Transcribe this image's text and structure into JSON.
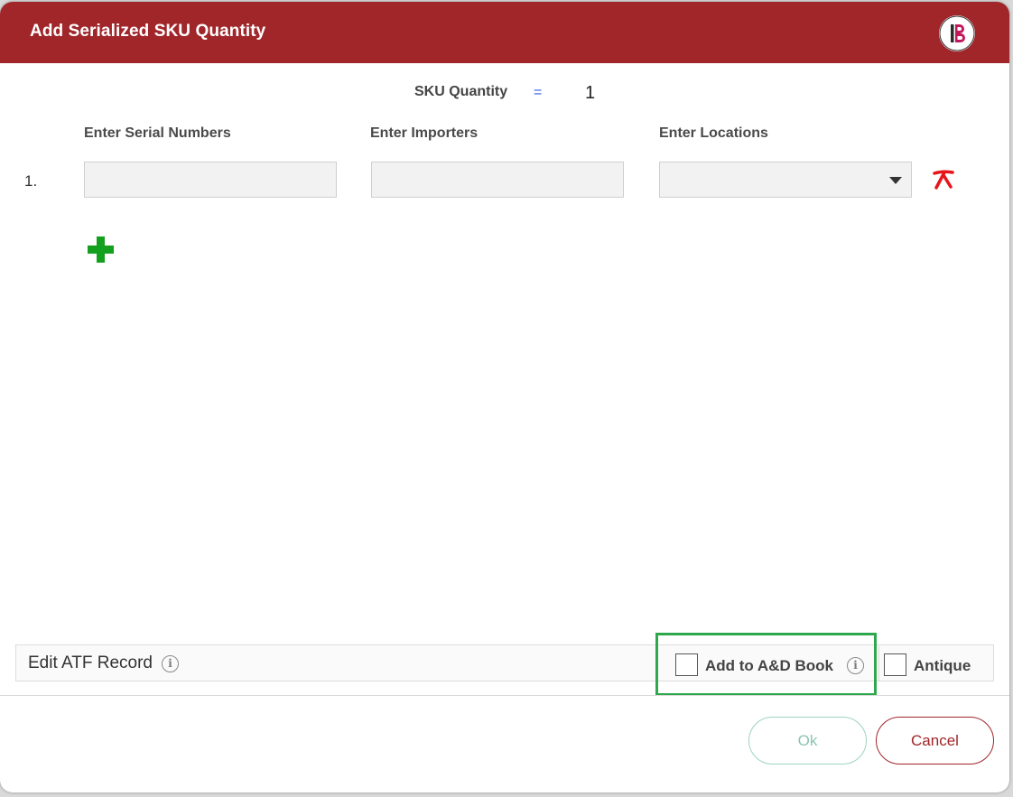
{
  "dialog": {
    "title": "Add Serialized SKU Quantity",
    "accent_color": "#a0262a",
    "logo_icon": "brand-b-logo"
  },
  "sku": {
    "label": "SKU Quantity",
    "operator": "=",
    "value": "1"
  },
  "columns": {
    "serial": "Enter Serial Numbers",
    "importers": "Enter Importers",
    "locations": "Enter Locations"
  },
  "rows": [
    {
      "index": "1.",
      "serial": "",
      "importer": "",
      "location": ""
    }
  ],
  "icons": {
    "remove": "remove-row-icon",
    "add": "add-row-icon",
    "info": "info-icon"
  },
  "atf": {
    "label": "Edit ATF Record",
    "info_glyph": "i"
  },
  "options": {
    "ad_book_label": "Add to A&D Book",
    "ad_book_checked": false,
    "antique_label": "Antique",
    "antique_checked": false,
    "highlight_color": "#2ea84c"
  },
  "buttons": {
    "ok": "Ok",
    "cancel": "Cancel"
  }
}
